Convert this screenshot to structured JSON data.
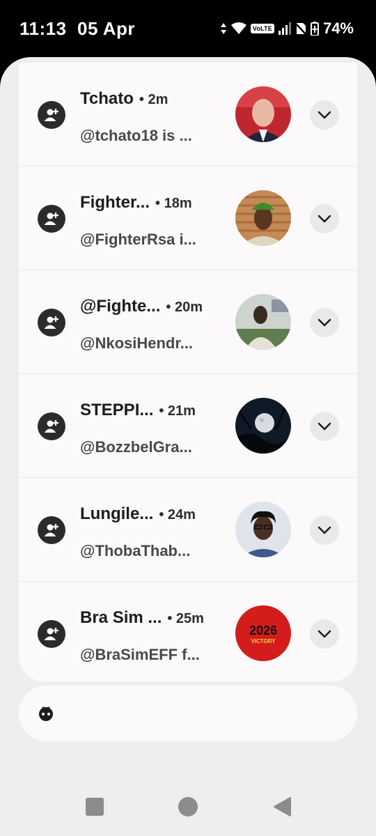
{
  "status_bar": {
    "time": "11:13",
    "date": "05 Apr",
    "volte_label": "VoLTE",
    "battery": "74%"
  },
  "notifications": [
    {
      "title": "Tchato",
      "time": "• 2m",
      "text": "@tchato18 is ..."
    },
    {
      "title": "Fighter...",
      "time": "• 18m",
      "text": "@FighterRsa i..."
    },
    {
      "title": "@Fighte...",
      "time": "• 20m",
      "text": "@NkosiHendr..."
    },
    {
      "title": "STEPPI...",
      "time": "• 21m",
      "text": "@BozzbelGra..."
    },
    {
      "title": "Lungile...",
      "time": "• 24m",
      "text": "@ThobaThab..."
    },
    {
      "title": "Bra Sim ...",
      "time": "• 25m",
      "text": "@BraSimEFF f..."
    }
  ],
  "avatar_6_text": {
    "year": "2026",
    "word": "VICTORY"
  },
  "icons": {
    "app_icon": "person-add-icon",
    "expand": "chevron-down-icon",
    "assistant": "assistant-face-icon",
    "nav": [
      "recents-square-icon",
      "home-circle-icon",
      "back-triangle-icon"
    ]
  }
}
